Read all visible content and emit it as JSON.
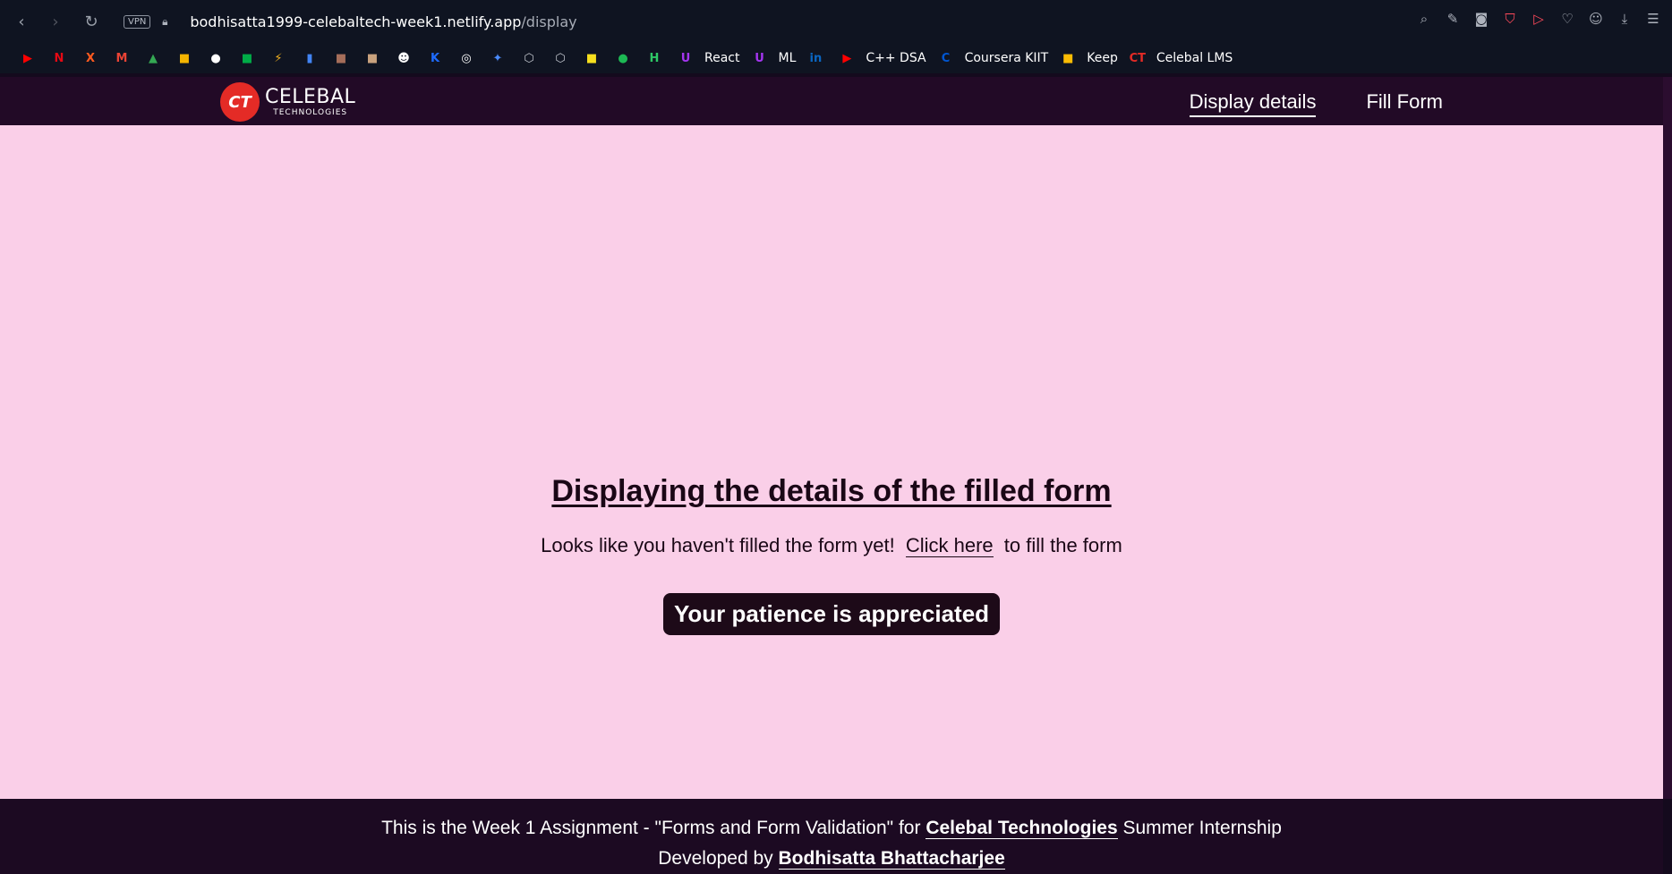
{
  "browser": {
    "vpn_label": "VPN",
    "url_host": "bodhisatta1999-celebaltech-week1.netlify.app",
    "url_path": "/display",
    "top_icons": [
      "search-icon",
      "edit-icon",
      "camera-icon",
      "shield-icon",
      "send-icon",
      "heart-icon",
      "profile-icon",
      "download-icon",
      "menu-icon"
    ]
  },
  "bookmarks": [
    {
      "icon": "youtube-icon",
      "label": "",
      "color": "#ff0000",
      "glyph": "▶"
    },
    {
      "icon": "netflix-icon",
      "label": "",
      "color": "#e50914",
      "glyph": "N"
    },
    {
      "icon": "x-icon",
      "label": "",
      "color": "#ff5a1f",
      "glyph": "X"
    },
    {
      "icon": "gmail-icon",
      "label": "",
      "color": "#ea4335",
      "glyph": "M"
    },
    {
      "icon": "drive-icon",
      "label": "",
      "color": "#34a853",
      "glyph": "▲"
    },
    {
      "icon": "classroom-icon",
      "label": "",
      "color": "#f4b400",
      "glyph": "■"
    },
    {
      "icon": "github-icon",
      "label": "",
      "color": "#ffffff",
      "glyph": "●"
    },
    {
      "icon": "meet-icon",
      "label": "",
      "color": "#00ac47",
      "glyph": "■"
    },
    {
      "icon": "flash-icon",
      "label": "",
      "color": "#f2b01e",
      "glyph": "⚡"
    },
    {
      "icon": "analytics-icon",
      "label": "",
      "color": "#4285f4",
      "glyph": "▮"
    },
    {
      "icon": "avatar-icon",
      "label": "",
      "color": "#a56e5a",
      "glyph": "■"
    },
    {
      "icon": "avatar-icon",
      "label": "",
      "color": "#c9a27e",
      "glyph": "■"
    },
    {
      "icon": "smiley-icon",
      "label": "",
      "color": "#ffffff",
      "glyph": "☻"
    },
    {
      "icon": "kotlin-icon",
      "label": "",
      "color": "#1e6bff",
      "glyph": "K"
    },
    {
      "icon": "openai-icon",
      "label": "",
      "color": "#ffffff",
      "glyph": "◎"
    },
    {
      "icon": "sparkle-icon",
      "label": "",
      "color": "#4a8bff",
      "glyph": "✦"
    },
    {
      "icon": "unity-icon",
      "label": "",
      "color": "#c4c8cf",
      "glyph": "⬡"
    },
    {
      "icon": "unity-icon",
      "label": "",
      "color": "#c4c8cf",
      "glyph": "⬡"
    },
    {
      "icon": "js-icon",
      "label": "",
      "color": "#f7df1e",
      "glyph": "■"
    },
    {
      "icon": "spotify-icon",
      "label": "",
      "color": "#1db954",
      "glyph": "●"
    },
    {
      "icon": "hackerrank-icon",
      "label": "",
      "color": "#2ec866",
      "glyph": "H"
    },
    {
      "icon": "udemy-icon",
      "label": "React",
      "color": "#a435f0",
      "glyph": "U"
    },
    {
      "icon": "udemy-icon",
      "label": "ML",
      "color": "#a435f0",
      "glyph": "U"
    },
    {
      "icon": "linkedin-icon",
      "label": "",
      "color": "#0a66c2",
      "glyph": "in"
    },
    {
      "icon": "youtube-icon",
      "label": "C++ DSA",
      "color": "#ff0000",
      "glyph": "▶"
    },
    {
      "icon": "coursera-icon",
      "label": "Coursera KIIT",
      "color": "#0056d2",
      "glyph": "C"
    },
    {
      "icon": "keep-icon",
      "label": "Keep",
      "color": "#fbbc04",
      "glyph": "■"
    },
    {
      "icon": "celebal-icon",
      "label": "Celebal LMS",
      "color": "#e42b26",
      "glyph": "CT"
    }
  ],
  "site": {
    "logo_mark": "CT",
    "logo_main": "CELEBAL",
    "logo_sub": "TECHNOLOGIES",
    "nav": {
      "display": "Display details",
      "fill": "Fill Form"
    }
  },
  "main": {
    "heading": "Displaying the details of the filled form",
    "message_before": "Looks like you haven't filled the form yet!",
    "link_text": "Click here",
    "message_after": "to fill the form",
    "patience": "Your patience is appreciated"
  },
  "footer": {
    "line1_before": "This is the Week 1 Assignment - \"Forms and Form Validation\" for",
    "line1_bold": "Celebal Technologies",
    "line1_after": "Summer Internship",
    "line2_before": "Developed by",
    "line2_bold": "Bodhisatta Bhattacharjee"
  }
}
